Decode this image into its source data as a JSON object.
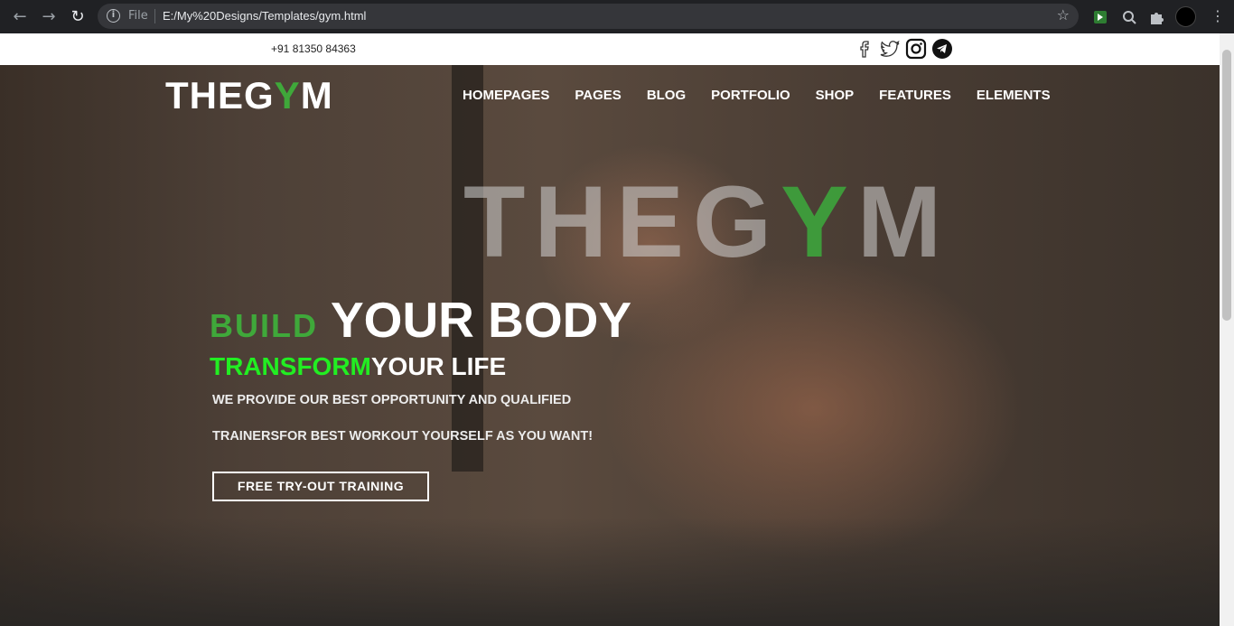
{
  "browser": {
    "back_icon": "arrow-left-icon",
    "forward_icon": "arrow-right-icon",
    "reload_icon": "reload-icon",
    "scheme_label": "File",
    "url": "E:/My%20Designs/Templates/gym.html"
  },
  "topbar": {
    "phone": "+91 81350 84363",
    "social": [
      "facebook-icon",
      "twitter-icon",
      "instagram-icon",
      "telegram-icon"
    ]
  },
  "brand": {
    "logo_prefix": "THEG",
    "logo_accent": "Y",
    "logo_suffix": "M",
    "accent_color": "#3fa83a"
  },
  "nav": {
    "items": [
      "HOMEPAGES",
      "PAGES",
      "BLOG",
      "PORTFOLIO",
      "SHOP",
      "FEATURES",
      "ELEMENTS"
    ]
  },
  "hero": {
    "watermark_prefix": "THEG",
    "watermark_accent": "Y",
    "watermark_suffix": "M",
    "build": "BUILD",
    "your_body": "YOUR BODY",
    "transform": "TRANSFORM",
    "your_life": "YOUR LIFE",
    "desc_line1": "WE PROVIDE OUR BEST OPPORTUNITY AND QUALIFIED",
    "desc_line2": "TRAINERSFOR BEST WORKOUT YOURSELF AS YOU WANT!",
    "cta": "FREE TRY-OUT TRAINING",
    "transform_color": "#22ee22"
  }
}
